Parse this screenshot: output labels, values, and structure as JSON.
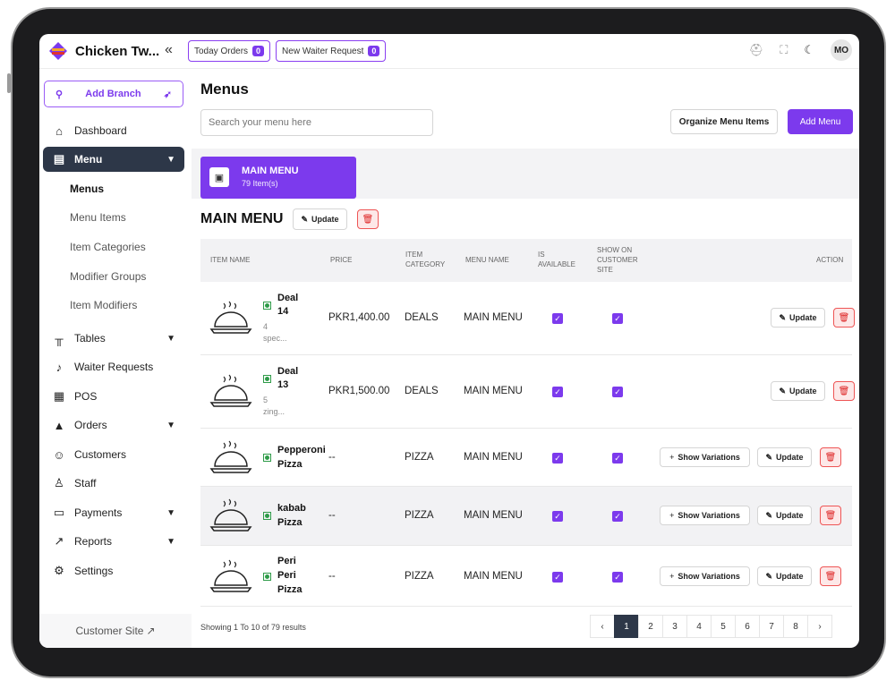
{
  "brand": {
    "name": "Chicken Tw..."
  },
  "topbar": {
    "today_orders_label": "Today Orders",
    "today_orders_count": "0",
    "waiter_request_label": "New Waiter Request",
    "waiter_request_count": "0",
    "avatar_initials": "MO"
  },
  "sidebar": {
    "add_branch": "Add Branch",
    "items": [
      {
        "label": "Dashboard",
        "icon": "home-icon"
      },
      {
        "label": "Menu",
        "icon": "menu-book-icon"
      },
      {
        "label": "Tables",
        "icon": "table-icon"
      },
      {
        "label": "Waiter Requests",
        "icon": "bell-icon"
      },
      {
        "label": "POS",
        "icon": "pos-icon"
      },
      {
        "label": "Orders",
        "icon": "orders-icon"
      },
      {
        "label": "Customers",
        "icon": "users-icon"
      },
      {
        "label": "Staff",
        "icon": "staff-icon"
      },
      {
        "label": "Payments",
        "icon": "wallet-icon"
      },
      {
        "label": "Reports",
        "icon": "chart-icon"
      },
      {
        "label": "Settings",
        "icon": "gear-icon"
      }
    ],
    "menu_sub": [
      "Menus",
      "Menu Items",
      "Item Categories",
      "Modifier Groups",
      "Item Modifiers"
    ],
    "customer_site": "Customer Site"
  },
  "main": {
    "title": "Menus",
    "search_placeholder": "Search your menu here",
    "organize_label": "Organize Menu Items",
    "add_menu_label": "Add Menu",
    "menu_card": {
      "name": "MAIN MENU",
      "count": "79 Item(s)"
    },
    "section_title": "MAIN MENU",
    "update_label": "Update",
    "columns": {
      "item_name": "ITEM NAME",
      "price": "PRICE",
      "item_category_1": "ITEM",
      "item_category_2": "CATEGORY",
      "menu_name": "MENU NAME",
      "is_available_1": "IS",
      "is_available_2": "AVAILABLE",
      "show_1": "SHOW ON",
      "show_2": "CUSTOMER",
      "show_3": "SITE",
      "action": "ACTION"
    },
    "rows": [
      {
        "name1": "Deal",
        "name2": "14",
        "name3": "",
        "desc1": "4",
        "desc2": "spec...",
        "price": "PKR1,400.00",
        "category": "DEALS",
        "menu": "MAIN MENU",
        "variations": ""
      },
      {
        "name1": "Deal",
        "name2": "13",
        "name3": "",
        "desc1": "5",
        "desc2": "zing...",
        "price": "PKR1,500.00",
        "category": "DEALS",
        "menu": "MAIN MENU",
        "variations": ""
      },
      {
        "name1": "Pepperoni",
        "name2": "Pizza",
        "name3": "",
        "desc1": "",
        "desc2": "",
        "price": "--",
        "category": "PIZZA",
        "menu": "MAIN MENU",
        "variations": "Show Variations"
      },
      {
        "name1": "kabab",
        "name2": "Pizza",
        "name3": "",
        "desc1": "",
        "desc2": "",
        "price": "--",
        "category": "PIZZA",
        "menu": "MAIN MENU",
        "variations": "Show Variations"
      },
      {
        "name1": "Peri",
        "name2": "Peri",
        "name3": "Pizza",
        "desc1": "",
        "desc2": "",
        "price": "--",
        "category": "PIZZA",
        "menu": "MAIN MENU",
        "variations": "Show Variations"
      }
    ],
    "showing_text": "Showing 1 To 10 of 79 results",
    "pages": [
      "1",
      "2",
      "3",
      "4",
      "5",
      "6",
      "7",
      "8"
    ]
  },
  "colors": {
    "accent": "#7c3aed",
    "dark": "#2d3748",
    "danger": "#dd2222"
  }
}
